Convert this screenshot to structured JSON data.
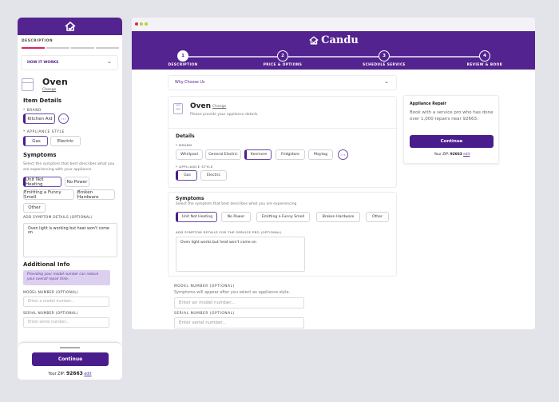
{
  "mobile": {
    "step_label": "DESCRIPTION",
    "how_it_works": "HOW IT WORKS",
    "appliance": "Oven",
    "change": "Change",
    "item_details": "Item Details",
    "brand_label": "* BRAND",
    "brand_selected": "Kitchen Aid",
    "style_label": "* APPLIANCE STYLE",
    "styles": [
      "Gas",
      "Electric"
    ],
    "symptoms_title": "Symptoms",
    "symptoms_desc": "Select the symptom that best describes what you are experiencing with your appliance.",
    "symptoms": [
      "Unit Not Heating",
      "No Power",
      "Emitting a Funny Smell",
      "Broken Hardware",
      "Other"
    ],
    "details_label": "ADD SYMPTOM DETAILS (OPTIONAL)",
    "details_value": "Oven light is working but heat won't come on",
    "additional_title": "Additional Info",
    "note": "Providing your model number can reduce your overall repair time.",
    "model_label": "MODEL NUMBER (OPTIONAL)",
    "model_placeholder": "Enter a model number...",
    "serial_label": "SERIAL NUMBER (OPTIONAL)",
    "serial_placeholder": "Enter serial number...",
    "continue": "Continue",
    "zip_prefix": "Your ZIP:",
    "zip": "92663",
    "edit": "edit"
  },
  "desktop": {
    "brand": "Candu",
    "steps": [
      {
        "num": "1",
        "label": "DESCRIPTION"
      },
      {
        "num": "2",
        "label": "PRICE & OPTIONS"
      },
      {
        "num": "3",
        "label": "SCHEDULE SERVICE"
      },
      {
        "num": "4",
        "label": "REVIEW & BOOK"
      }
    ],
    "why": "Why Choose Us",
    "appliance": "Oven",
    "change": "Change",
    "subtitle": "Please provide your appliance details.",
    "details_title": "Details",
    "brand_label": "* BRAND",
    "brands": [
      "Whirlpool",
      "General Electric",
      "Kenmore",
      "Fridgidare",
      "Maytag"
    ],
    "style_label": "* APPLIANCE STYLE",
    "styles": [
      "Gas",
      "Electric"
    ],
    "symptoms_title": "Symptoms",
    "symptoms_desc": "Select the symptom that best describes what you are experiencing",
    "symptoms": [
      "Unit Not Heating",
      "No Power",
      "Emitting a Funny Smell",
      "Broken Hardware",
      "Other"
    ],
    "details_label": "ADD SYMPTOM DETAILS FOR THE SERVICE PRO (OPTIONAL)",
    "details_value": "Oven light works but heat won't come on",
    "model_label": "MODEL NUMBER (OPTIONAL)",
    "model_hint": "Symptoms will appear after you select an appliance style.",
    "model_placeholder": "Enter an model number...",
    "serial_label": "SERIAL NUMBER (OPTIONAL)",
    "serial_placeholder": "Enter serial number...",
    "side": {
      "title": "Appliance Repair",
      "text": "Book with a service pro who has done over 1,000 repairs near 92663.",
      "continue": "Continue",
      "zip_prefix": "Your ZIP:",
      "zip": "92663",
      "edit": "edit"
    }
  },
  "colors": {
    "brand": "#53238f",
    "accent": "#e0245e"
  }
}
